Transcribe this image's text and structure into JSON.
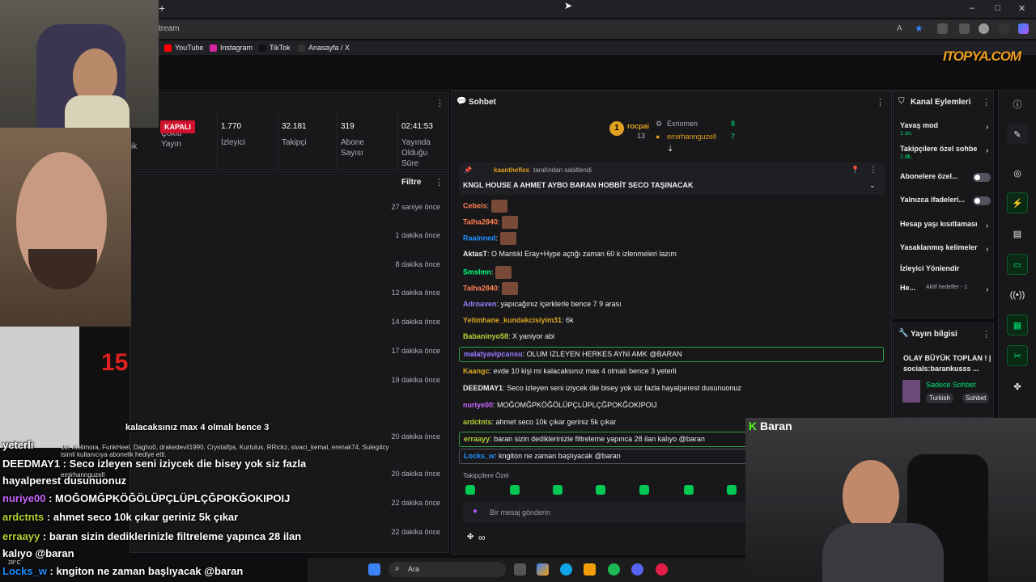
{
  "browser": {
    "url": "tream",
    "bookmarks": [
      {
        "label": "YouTube",
        "color": "#ff0000"
      },
      {
        "label": "Instagram",
        "color": "#d6249f"
      },
      {
        "label": "TikTok",
        "color": "#111111"
      },
      {
        "label": "Anasayfa / X",
        "color": "#333333"
      }
    ]
  },
  "logo": "ITOPYA.COM",
  "stats": {
    "status_badge": "KAPALI",
    "cut_label": "ik",
    "items": [
      {
        "value": "",
        "label": "Çoklu Yayın"
      },
      {
        "value": "1.770",
        "label": "İzleyici"
      },
      {
        "value": "32.181",
        "label": "Takipçi"
      },
      {
        "value": "319",
        "label": "Abone Sayısı"
      },
      {
        "value": "02:41:53",
        "label": "Yayında Olduğu Süre"
      }
    ]
  },
  "activity": {
    "filter_label": "Filtre",
    "times": [
      "27 saniye önce",
      "1 dakika önce",
      "8 dakika önce",
      "12 dakika önce",
      "14 dakika önce",
      "17 dakika önce",
      "19 dakika önce",
      "20 dakika önce",
      "20 dakika önce",
      "22 dakika önce",
      "22 dakika önce"
    ]
  },
  "chat": {
    "title": "Sohbet",
    "leaderboard": {
      "first": {
        "rank": "1",
        "name": "rocpai",
        "count": "13"
      },
      "second": {
        "name": "Exriomen",
        "count": "8"
      },
      "third": {
        "name": "emirhannguzell",
        "count": "7"
      }
    },
    "pinned": {
      "by": "kaantheflex",
      "by_suffix": "tarafından sabitlendi",
      "text": "KNGL HOUSE A AHMET AYBO BARAN HOBBİT SECO TAŞINACAK"
    },
    "messages": [
      {
        "user": "Cebeis",
        "color": "#ff7f50",
        "text": "",
        "emote": true
      },
      {
        "user": "Talha2840",
        "color": "#ff7f50",
        "text": "",
        "emote": true
      },
      {
        "user": "Raainned",
        "color": "#1e90ff",
        "text": "",
        "emote": true
      },
      {
        "user": "AktasT",
        "color": "#efeff1",
        "text": "O Mantıkl Eray+Hype açtığı zaman 60 k izlenmeleri lazım",
        "emote": false
      },
      {
        "user": "Smslmn",
        "color": "#00ff7f",
        "text": "",
        "emote": true
      },
      {
        "user": "Talha2840",
        "color": "#ff7f50",
        "text": "",
        "emote": true
      },
      {
        "user": "Adroaven",
        "color": "#9b7bff",
        "text": "yapıcağınız içerklerle bence 7 9 arası",
        "emote": false
      },
      {
        "user": "Yetimhane_kundakcisiyim31",
        "color": "#daa520",
        "text": "6k",
        "emote": false
      },
      {
        "user": "Babaninyo58",
        "color": "#b2d234",
        "text": "X yaniyor abi",
        "emote": false
      },
      {
        "user": "malatyavipcansu",
        "color": "#9b7bff",
        "text": "OLUM IZLEYEN HERKES AYNI AMK @BARAN",
        "emote": false,
        "highlight": true
      },
      {
        "user": "Kaangc",
        "color": "#daa520",
        "text": "evde 10 kişi mi kalacaksınız max 4 olmalı bence 3 yeterli",
        "emote": false
      },
      {
        "user": "DEEDMAY1",
        "color": "#efeff1",
        "text": "Seco izleyen seni iziycek die bisey yok siz fazla hayalperest dusunuonuz",
        "emote": false
      },
      {
        "user": "nuriye00",
        "color": "#cc66ff",
        "text": "MOĞOMĞPKÖĞÖLÜPÇLÜPLÇĞPOKĞOKIPOIJ",
        "emote": false
      },
      {
        "user": "ardctnts",
        "color": "#b2d234",
        "text": "ahmet seco 10k çıkar geriniz 5k çıkar",
        "emote": false
      },
      {
        "user": "erraayy",
        "color": "#b2d234",
        "text": "baran sizin dediklerinizle filtreleme yapınca 28 ilan kalıyo @baran",
        "emote": false,
        "highlight": true
      },
      {
        "user": "Locks_w",
        "color": "#1e90ff",
        "text": "kngiton ne zaman başlıyacak @baran",
        "emote": false,
        "highlight": true
      }
    ],
    "followers_only": "Takipçilere Özel",
    "input_placeholder": "Bir mesaj gönderin",
    "points": "∞"
  },
  "channel_actions": {
    "title": "Kanal Eylemleri",
    "items": [
      {
        "label": "Yavaş mod",
        "sub": "1 sn.",
        "type": "arrow"
      },
      {
        "label": "Takipçilere özel sohbe",
        "sub": "1 dk.",
        "type": "arrow"
      },
      {
        "label": "Abonelere özel...",
        "sub": "",
        "type": "toggle"
      },
      {
        "label": "Yalnızca ifadeleri...",
        "sub": "",
        "type": "toggle"
      },
      {
        "label": "Hesap yaşı kısıtlaması",
        "sub": "",
        "type": "arrow"
      },
      {
        "label": "Yasaklanmış kelimeler",
        "sub": "",
        "type": "arrow"
      },
      {
        "label": "İzleyici Yönlendir",
        "sub": "",
        "type": "none"
      },
      {
        "label": "He...",
        "sub": "Aktif hedefler - 1",
        "type": "arrow"
      }
    ]
  },
  "stream_info": {
    "title": "Yayın bilgisi",
    "stream_title": "OLAY BÜYÜK TOPLAN ! | socials:barankusss ...",
    "category": "Sadece Sohbet",
    "tags": [
      "Turkish",
      "Sohbet"
    ]
  },
  "overlay": {
    "streamer_name": "Baran",
    "lines": [
      {
        "user": "",
        "text": "kalacaksınız max 4 olmalı bence 3"
      },
      {
        "user": "yeterli",
        "text": ""
      },
      {
        "user": "DEEDMAY1",
        "text": " : Seco izleyen seni iziycek die bisey yok siz fazla"
      },
      {
        "user": "",
        "text": "hayalperest dusunuonuz"
      },
      {
        "user": "nuriye00",
        "text": " : MOĞOMĞPKÖĞÖLÜPÇLÜPLÇĞPOKĞOKIPOIJ"
      },
      {
        "user": "ardctnts",
        "text": " : ahmet seco 10k çıkar geriniz 5k çıkar"
      },
      {
        "user": "erraayy",
        "text": " : baran sizin dediklerinizle filtreleme yapınca 28 ilan"
      },
      {
        "user": "",
        "text": "kalıyo @baran"
      },
      {
        "user": "Locks_w",
        "text": " : kngiton ne zaman başlıyacak @baran"
      }
    ],
    "gift_names": "10, Kielimora, FunkHeel, Dagho0, drakedevil1990, Crystalfps, Kurtulus, RRickz, sivaci_kemal, erenak74, Suleg4cy",
    "gift_note": "isimli kullanıcıya abonelik hediye etti.",
    "gifter": "emirhannguzell"
  },
  "taskbar": {
    "search": "Ara",
    "weather": "28°C"
  },
  "colors": {
    "accent_green": "#00e676",
    "kick_green": "#53fc18",
    "badge_red": "#d0112b"
  }
}
